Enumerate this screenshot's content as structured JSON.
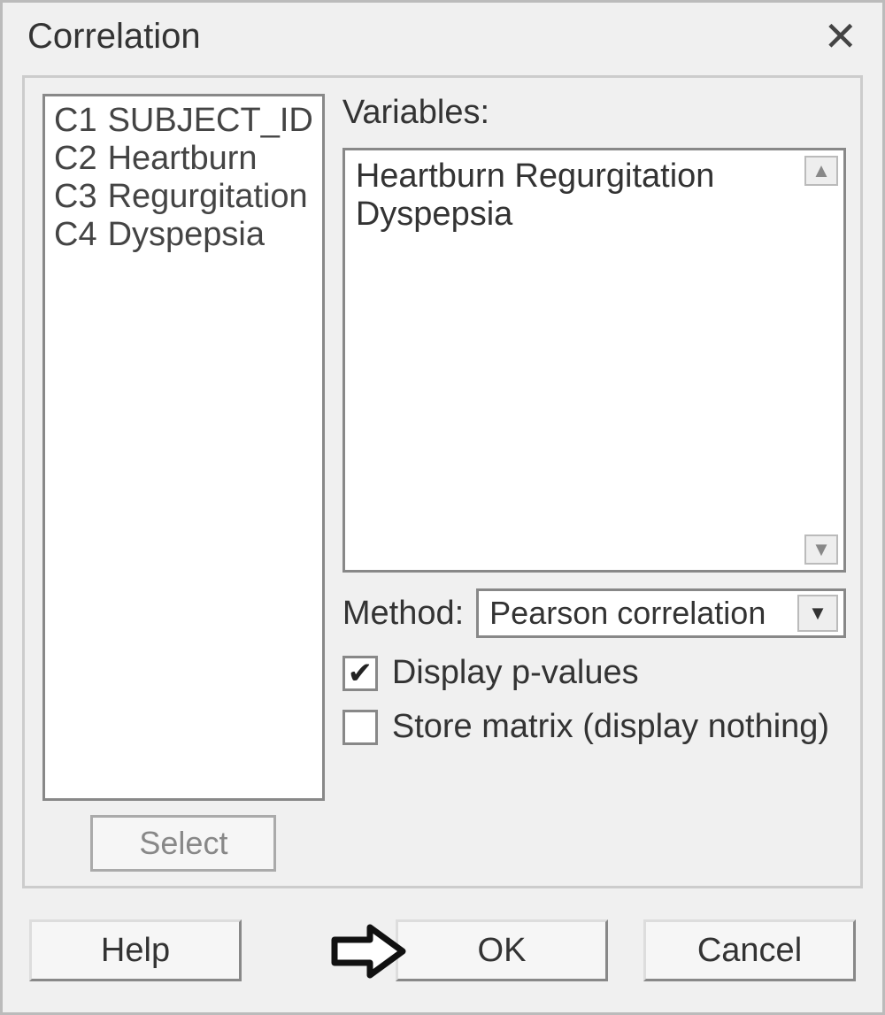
{
  "dialog": {
    "title": "Correlation"
  },
  "columns": [
    {
      "code": "C1",
      "name": "SUBJECT_ID"
    },
    {
      "code": "C2",
      "name": "Heartburn"
    },
    {
      "code": "C3",
      "name": "Regurgitation"
    },
    {
      "code": "C4",
      "name": "Dyspepsia"
    }
  ],
  "select_button": "Select",
  "variables": {
    "label": "Variables:",
    "text": "Heartburn Regurgitation Dyspepsia"
  },
  "method": {
    "label": "Method:",
    "selected": "Pearson correlation"
  },
  "checkboxes": {
    "display_p_values": {
      "label": "Display p-values",
      "checked": true
    },
    "store_matrix": {
      "label": "Store matrix (display nothing)",
      "checked": false
    }
  },
  "buttons": {
    "help": "Help",
    "ok": "OK",
    "cancel": "Cancel"
  }
}
